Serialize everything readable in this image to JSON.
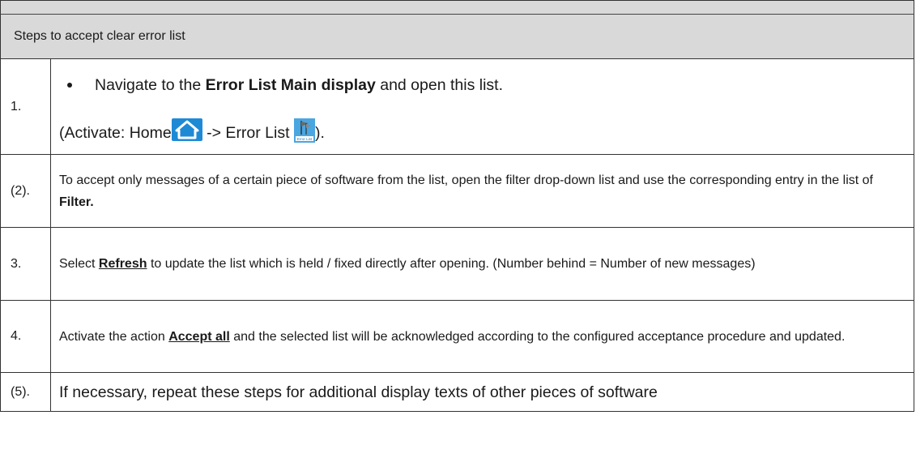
{
  "header": {
    "title": "Steps to accept clear error list"
  },
  "steps": [
    {
      "number": "1.",
      "pre": "Navigate to the ",
      "bold": "Error List Main display",
      "post": " and open this list.",
      "activate_prefix": "(Activate: Home",
      "activate_mid": " -> Error List ",
      "activate_suffix": ").",
      "icons": [
        "home-icon",
        "error-list-icon"
      ]
    },
    {
      "number": "(2).",
      "text": "To accept only messages of a certain piece of software from the list, open the filter drop-down list and use the corresponding entry in the list of ",
      "bold": "Filter."
    },
    {
      "number": "3.",
      "pre": "Select ",
      "bold": "Refresh",
      "post": " to update the list which is held / fixed directly after opening. (Number behind = Number of new messages)"
    },
    {
      "number": "4.",
      "pre": "Activate the action ",
      "bold": "Accept all",
      "post": " and the selected list will be acknowledged according to the configured acceptance procedure and updated."
    },
    {
      "number": "(5).",
      "text": "If necessary, repeat these steps for additional display texts of other pieces of software"
    }
  ],
  "colors": {
    "header_bg": "#d9d9d9",
    "border": "#333333",
    "icon_blue": "#1e8ad6"
  }
}
